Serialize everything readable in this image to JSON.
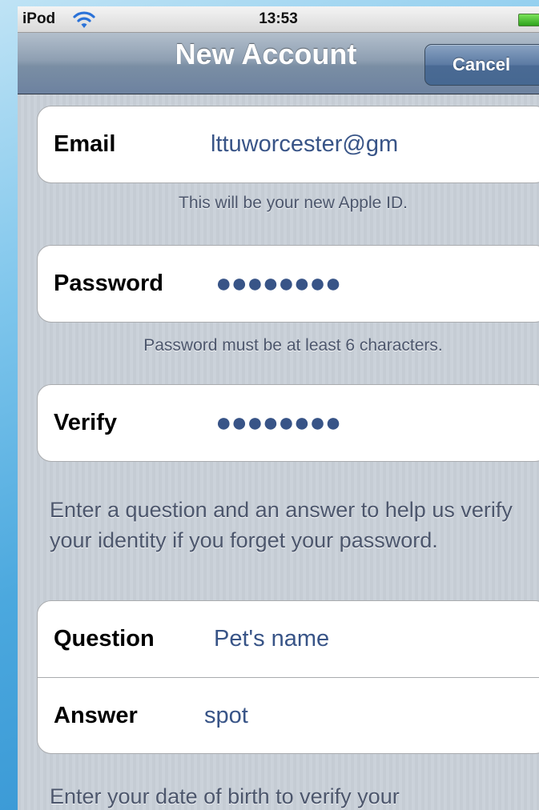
{
  "status_bar": {
    "carrier": "iPod",
    "time": "13:53",
    "wifi_icon": "wifi-icon",
    "battery_icon": "battery-icon",
    "battery_color": "#4cc03a"
  },
  "nav_bar": {
    "title": "New Account",
    "cancel_label": "Cancel"
  },
  "form": {
    "email": {
      "label": "Email",
      "value": "lttuworcester@gm"
    },
    "email_hint": "This will be your new Apple ID.",
    "password": {
      "label": "Password",
      "value": "●●●●●●●●"
    },
    "password_hint": "Password must be at least 6 characters.",
    "verify": {
      "label": "Verify",
      "value": "●●●●●●●●"
    },
    "security_text": "Enter a question and an answer to help us verify your identity if you forget your password.",
    "question": {
      "label": "Question",
      "value": "Pet's name"
    },
    "answer": {
      "label": "Answer",
      "value": "spot"
    },
    "dob_text": "Enter your date of birth to verify your"
  },
  "colors": {
    "field_value": "#385487",
    "nav_bar": "#6d82a0",
    "background_stripes": "#c5ccd4"
  }
}
